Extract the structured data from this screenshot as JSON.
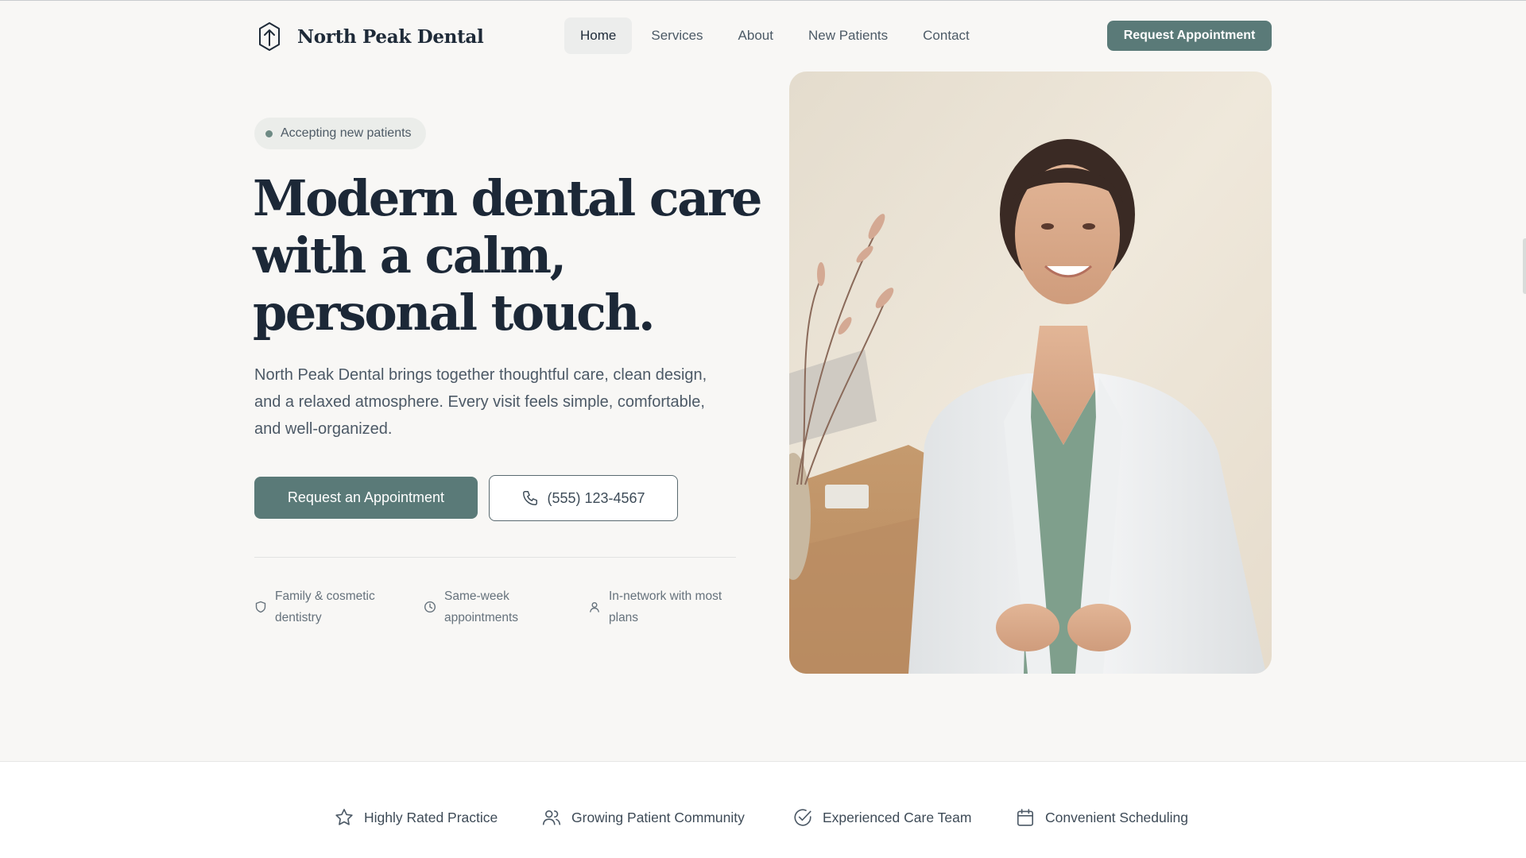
{
  "brand": {
    "name": "North Peak Dental",
    "icon": "mountain-shield-icon"
  },
  "nav": {
    "links": [
      {
        "label": "Home",
        "active": true
      },
      {
        "label": "Services",
        "active": false
      },
      {
        "label": "About",
        "active": false
      },
      {
        "label": "New Patients",
        "active": false
      },
      {
        "label": "Contact",
        "active": false
      }
    ],
    "cta_label": "Request Appointment"
  },
  "hero": {
    "badge": "Accepting new patients",
    "headline": "Modern dental care with a calm, personal touch.",
    "lead": "North Peak Dental brings together thoughtful care, clean design, and a relaxed atmosphere. Every visit feels simple, comfortable, and well-organized.",
    "primary_cta": "Request an Appointment",
    "phone": "(555) 123-4567",
    "phone_icon": "phone-icon",
    "features": [
      {
        "icon": "shield-icon",
        "text": "Family & cosmetic dentistry"
      },
      {
        "icon": "clock-icon",
        "text": "Same-week appointments"
      },
      {
        "icon": "person-icon",
        "text": "In-network with most plans"
      }
    ]
  },
  "trust_bar": {
    "items": [
      {
        "icon": "star-icon",
        "label": "Highly Rated Practice"
      },
      {
        "icon": "users-icon",
        "label": "Growing Patient Community"
      },
      {
        "icon": "check-circle-icon",
        "label": "Experienced Care Team"
      },
      {
        "icon": "calendar-icon",
        "label": "Convenient Scheduling"
      }
    ]
  },
  "colors": {
    "accent": "#5a7a78",
    "page_bg": "#f8f7f5",
    "heading": "#1c2837",
    "body_text": "#4c5966"
  }
}
